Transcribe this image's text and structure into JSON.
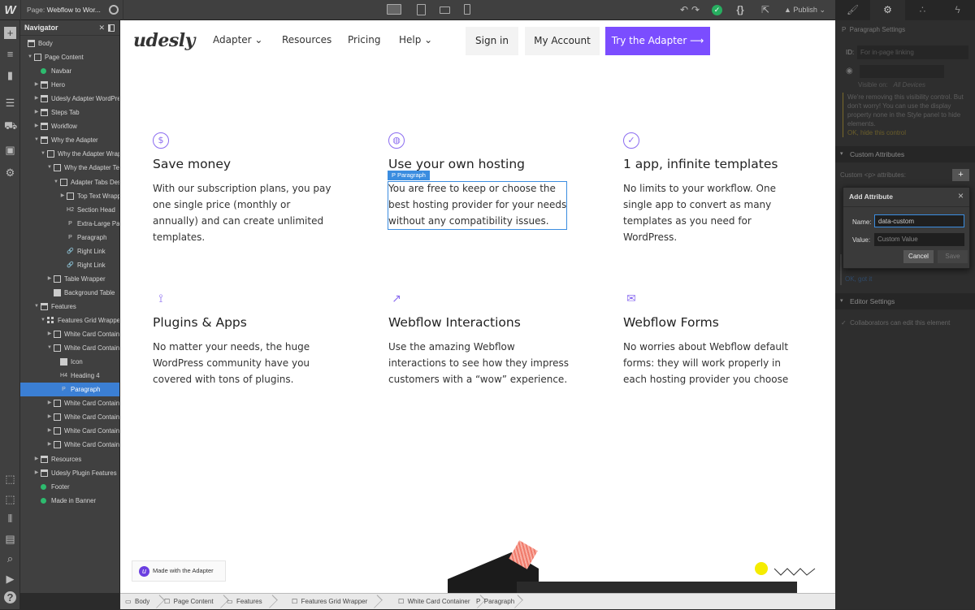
{
  "topbar": {
    "logo": "W",
    "page_label": "Page:",
    "page_name": "Webflow to Wor...",
    "publish": "Publish"
  },
  "navigator": {
    "title": "Navigator",
    "items": [
      {
        "label": "Body",
        "level": 0,
        "icon": "sec",
        "caret": ""
      },
      {
        "label": "Page Content",
        "level": 1,
        "icon": "box",
        "caret": "open"
      },
      {
        "label": "Navbar",
        "level": 2,
        "icon": "comp",
        "caret": ""
      },
      {
        "label": "Hero",
        "level": 2,
        "icon": "sec",
        "caret": "closed"
      },
      {
        "label": "Udesly Adapter WordPress",
        "level": 2,
        "icon": "sec",
        "caret": "closed"
      },
      {
        "label": "Steps Tab",
        "level": 2,
        "icon": "sec",
        "caret": "closed"
      },
      {
        "label": "Workflow",
        "level": 2,
        "icon": "sec",
        "caret": "closed"
      },
      {
        "label": "Why the Adapter",
        "level": 2,
        "icon": "sec",
        "caret": "open"
      },
      {
        "label": "Why the Adapter Wrapper",
        "level": 3,
        "icon": "box",
        "caret": "open"
      },
      {
        "label": "Why the Adapter Text",
        "level": 4,
        "icon": "box",
        "caret": "open"
      },
      {
        "label": "Adapter Tabs Description",
        "level": 5,
        "icon": "box",
        "caret": "open"
      },
      {
        "label": "Top Text Wrapper",
        "level": 6,
        "icon": "box",
        "caret": "closed"
      },
      {
        "label": "Section Head",
        "level": 6,
        "icon": "H2",
        "caret": ""
      },
      {
        "label": "Extra-Large Paragraph",
        "level": 6,
        "icon": "P",
        "caret": ""
      },
      {
        "label": "Paragraph",
        "level": 6,
        "icon": "P",
        "caret": ""
      },
      {
        "label": "Right Link",
        "level": 6,
        "icon": "link",
        "caret": ""
      },
      {
        "label": "Right Link",
        "level": 6,
        "icon": "link",
        "caret": ""
      },
      {
        "label": "Table Wrapper",
        "level": 4,
        "icon": "box",
        "caret": "closed"
      },
      {
        "label": "Background Table",
        "level": 4,
        "icon": "img",
        "caret": ""
      },
      {
        "label": "Features",
        "level": 2,
        "icon": "sec",
        "caret": "open"
      },
      {
        "label": "Features Grid Wrapper",
        "level": 3,
        "icon": "grid",
        "caret": "open"
      },
      {
        "label": "White Card Container",
        "level": 4,
        "icon": "box",
        "caret": "closed"
      },
      {
        "label": "White Card Container",
        "level": 4,
        "icon": "box",
        "caret": "open"
      },
      {
        "label": "Icon",
        "level": 5,
        "icon": "img",
        "caret": ""
      },
      {
        "label": "Heading 4",
        "level": 5,
        "icon": "H4",
        "caret": ""
      },
      {
        "label": "Paragraph",
        "level": 5,
        "icon": "P",
        "caret": "",
        "selected": true
      },
      {
        "label": "White Card Container",
        "level": 4,
        "icon": "box",
        "caret": "closed"
      },
      {
        "label": "White Card Container",
        "level": 4,
        "icon": "box",
        "caret": "closed"
      },
      {
        "label": "White Card Container",
        "level": 4,
        "icon": "box",
        "caret": "closed"
      },
      {
        "label": "White Card Container",
        "level": 4,
        "icon": "box",
        "caret": "closed"
      },
      {
        "label": "Resources",
        "level": 2,
        "icon": "sec",
        "caret": "closed"
      },
      {
        "label": "Udesly Plugin Features",
        "level": 2,
        "icon": "sec",
        "caret": "closed"
      },
      {
        "label": "Footer",
        "level": 2,
        "icon": "comp",
        "caret": ""
      },
      {
        "label": "Made in Banner",
        "level": 2,
        "icon": "comp",
        "caret": ""
      }
    ]
  },
  "site": {
    "brand": "udesly",
    "nav": [
      "Adapter",
      "Resources",
      "Pricing",
      "Help"
    ],
    "sign_in": "Sign in",
    "my_account": "My Account",
    "cta": "Try the Adapter ⟶",
    "accent": "#7b4dff",
    "features": [
      {
        "icon": "$",
        "title": "Save money",
        "text": "With our subscription plans, you pay one single price (monthly or annually) and can create unlimited templates."
      },
      {
        "icon": "◍",
        "title": "Use your own hosting",
        "text": "You are free to keep or choose the best hosting provider for your needs without any compatibility issues."
      },
      {
        "icon": "✓",
        "title": "1 app, infinite templates",
        "text": "No limits to your workflow. One single app to convert as many templates as you need for WordPress."
      },
      {
        "icon": "⟟",
        "title": "Plugins & Apps",
        "text": "No matter your needs, the huge WordPress community have you covered with tons of plugins."
      },
      {
        "icon": "↗",
        "title": "Webflow Interactions",
        "text": "Use the amazing Webflow interactions to see how they impress customers with a “wow” experience."
      },
      {
        "icon": "✉",
        "title": "Webflow Forms",
        "text": "No worries about Webflow default forms: they will work properly in each hosting provider you choose"
      }
    ],
    "selection_tag": "P  Paragraph",
    "made_badge": "Made with the Adapter"
  },
  "breadcrumbs": [
    "Body",
    "Page Content",
    "Features",
    "Features Grid Wrapper",
    "White Card Container",
    "Paragraph"
  ],
  "panel": {
    "title": "Paragraph Settings",
    "id_label": "ID:",
    "id_placeholder": "For in-page linking",
    "visible_on": "Visible on:",
    "all_devices": "All Devices",
    "notice": "We're removing this visibility control. But don't worry! You can use the display property none in the Style panel to hide elements.",
    "notice_link": "OK, hide this control",
    "custom_attrs": "Custom Attributes",
    "custom_attrs_label": "Custom <p> attributes:",
    "ok_got_it": "OK, got it",
    "editor_settings": "Editor Settings",
    "collab": "Collaborators can edit this element"
  },
  "dialog": {
    "title": "Add Attribute",
    "name_label": "Name:",
    "name_value": "data-custom",
    "value_label": "Value:",
    "value_placeholder": "Custom Value",
    "cancel": "Cancel",
    "save": "Save"
  }
}
